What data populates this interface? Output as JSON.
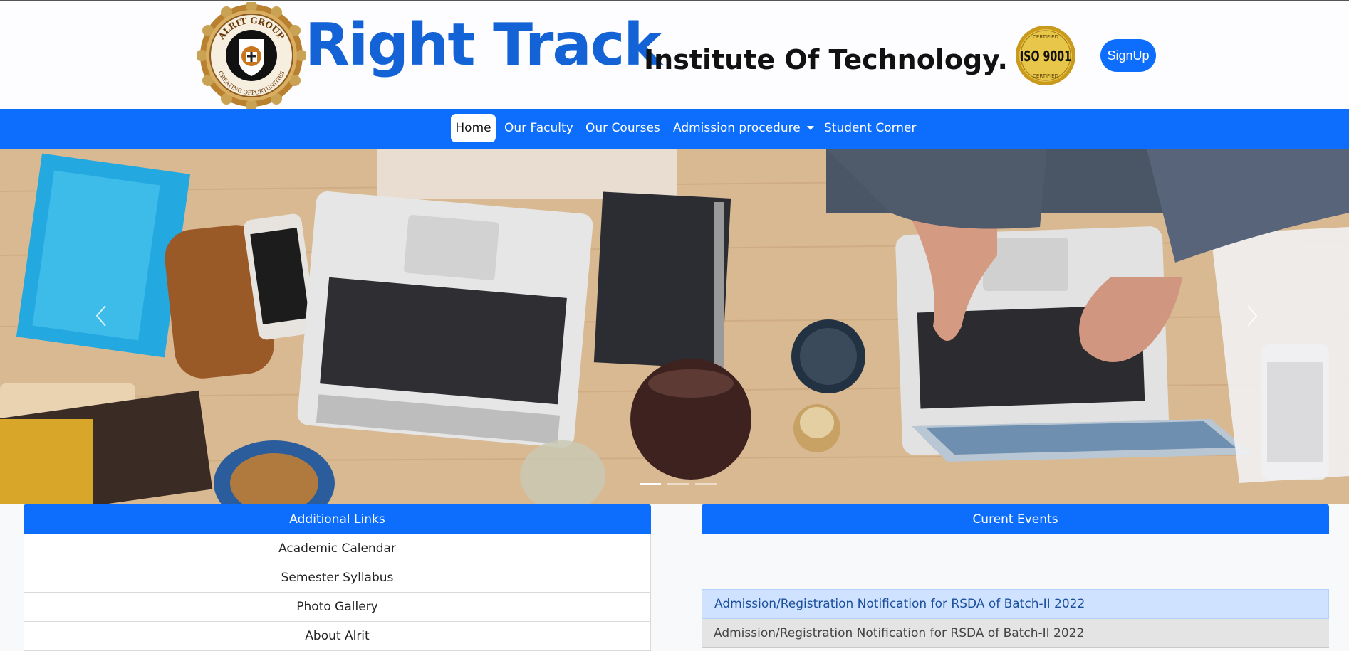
{
  "header": {
    "seal_text_top": "ALRIT GROUP",
    "seal_text_bottom": "CREATING OPPORTUNITIES",
    "brand_title": "Right Track",
    "brand_subtitle": "Institute Of Technology.",
    "iso_text": "ISO 9001",
    "iso_ring_text": "CERTIFIED",
    "signup_label": "SignUp"
  },
  "nav": {
    "items": [
      {
        "label": "Home",
        "active": true
      },
      {
        "label": "Our Faculty"
      },
      {
        "label": "Our Courses"
      },
      {
        "label": "Admission procedure",
        "dropdown": true
      },
      {
        "label": "Student Corner"
      }
    ]
  },
  "carousel": {
    "slides_count": 3,
    "active_slide": 1
  },
  "additional_links": {
    "title": "Additional Links",
    "items": [
      "Academic Calendar",
      "Semester Syllabus",
      "Photo Gallery",
      "About Alrit"
    ]
  },
  "events": {
    "title": "Curent Events",
    "items": [
      "Admission/Registration Notification for RSDA of Batch-II 2022",
      "Admission/Registration Notification for RSDA of Batch-II 2022"
    ]
  },
  "colors": {
    "primary": "#0d6efd",
    "brand_blue": "#1463d6",
    "highlight": "#cfe2ff"
  }
}
